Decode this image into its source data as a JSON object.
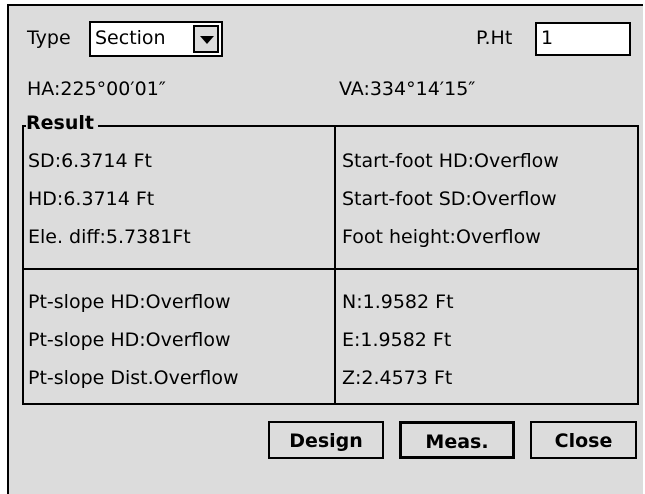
{
  "form": {
    "type_label": "Type",
    "type_value": "Section",
    "pht_label": "P.Ht",
    "pht_value": "1",
    "ha": "HA:225°00′01″",
    "va": "VA:334°14′15″"
  },
  "result": {
    "title": "Result",
    "left_top": [
      "SD:6.3714 Ft",
      "HD:6.3714 Ft",
      "Ele. diff:5.7381Ft"
    ],
    "right_top": [
      "Start-foot HD:Overflow",
      "Start-foot SD:Overflow",
      "Foot height:Overflow"
    ],
    "left_bottom": [
      "Pt-slope HD:Overflow",
      "Pt-slope HD:Overflow",
      "Pt-slope Dist.Overflow"
    ],
    "right_bottom": [
      "N:1.9582 Ft",
      "E:1.9582 Ft",
      "Z:2.4573 Ft"
    ]
  },
  "buttons": {
    "design": "Design",
    "meas": "Meas.",
    "close": "Close"
  }
}
